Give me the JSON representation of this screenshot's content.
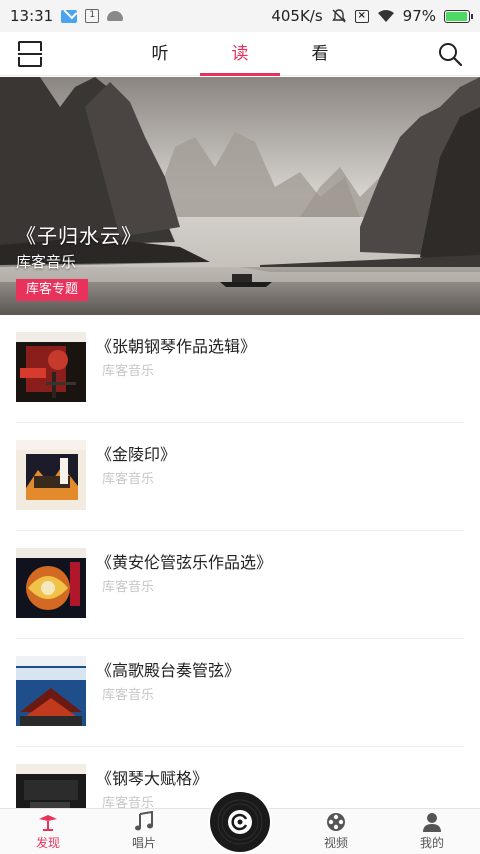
{
  "status_bar": {
    "time": "13:31",
    "calendar_day": "1",
    "network_speed": "405K/s",
    "battery_percent": "97%",
    "icons": [
      "mail-icon",
      "calendar-icon",
      "android-icon",
      "bell-off-icon",
      "x-box-icon",
      "wifi-icon",
      "battery-icon"
    ]
  },
  "top_nav": {
    "tabs": [
      {
        "label": "听",
        "active": false
      },
      {
        "label": "读",
        "active": true
      },
      {
        "label": "看",
        "active": false
      }
    ],
    "icons": [
      "menu-icon",
      "search-icon"
    ],
    "accent_color": "#e8325c"
  },
  "banner": {
    "title": "《子归水云》",
    "subtitle": "库客音乐",
    "badge": "库客专题"
  },
  "albums": [
    {
      "title": "《张朝钢琴作品选辑》",
      "artist": "库客音乐"
    },
    {
      "title": "《金陵印》",
      "artist": "库客音乐"
    },
    {
      "title": "《黄安伦管弦乐作品选》",
      "artist": "库客音乐"
    },
    {
      "title": "《高歌殿台奏管弦》",
      "artist": "库客音乐"
    },
    {
      "title": "《钢琴大赋格》",
      "artist": "库客音乐"
    }
  ],
  "bottom_nav": {
    "items": [
      {
        "label": "发现",
        "icon": "discover-icon",
        "active": true
      },
      {
        "label": "唱片",
        "icon": "music-note-icon",
        "active": false
      },
      {
        "label": "视频",
        "icon": "film-reel-icon",
        "active": false
      },
      {
        "label": "我的",
        "icon": "user-icon",
        "active": false
      }
    ],
    "center_button_icon": "vinyl-player-icon"
  }
}
